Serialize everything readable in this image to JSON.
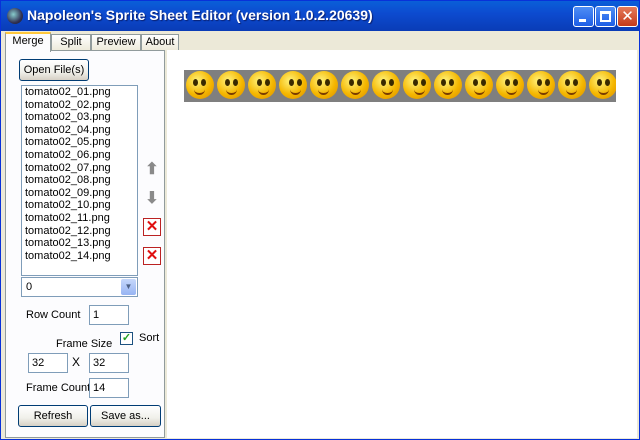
{
  "window": {
    "title": "Napoleon's Sprite Sheet Editor (version 1.0.2.20639)"
  },
  "tabs": [
    {
      "label": "Merge",
      "active": true
    },
    {
      "label": "Split",
      "active": false
    },
    {
      "label": "Preview",
      "active": false
    },
    {
      "label": "About",
      "active": false
    }
  ],
  "merge": {
    "open_files_label": "Open File(s)",
    "files": [
      "tomato02_01.png",
      "tomato02_02.png",
      "tomato02_03.png",
      "tomato02_04.png",
      "tomato02_05.png",
      "tomato02_06.png",
      "tomato02_07.png",
      "tomato02_08.png",
      "tomato02_09.png",
      "tomato02_10.png",
      "tomato02_11.png",
      "tomato02_12.png",
      "tomato02_13.png",
      "tomato02_14.png"
    ],
    "combo_value": "0",
    "row_count_label": "Row Count",
    "row_count_value": "1",
    "sort_label": "Sort",
    "sort_checked": true,
    "frame_size_label": "Frame Size",
    "frame_width": "32",
    "times_label": "X",
    "frame_height": "32",
    "frame_count_label": "Frame Count",
    "frame_count_value": "14",
    "refresh_label": "Refresh",
    "save_as_label": "Save as..."
  },
  "icons": {
    "up": "up-arrow-icon",
    "down": "down-arrow-icon",
    "remove": "delete-icon",
    "clear": "delete-all-icon"
  },
  "preview": {
    "frame_count": 14
  }
}
